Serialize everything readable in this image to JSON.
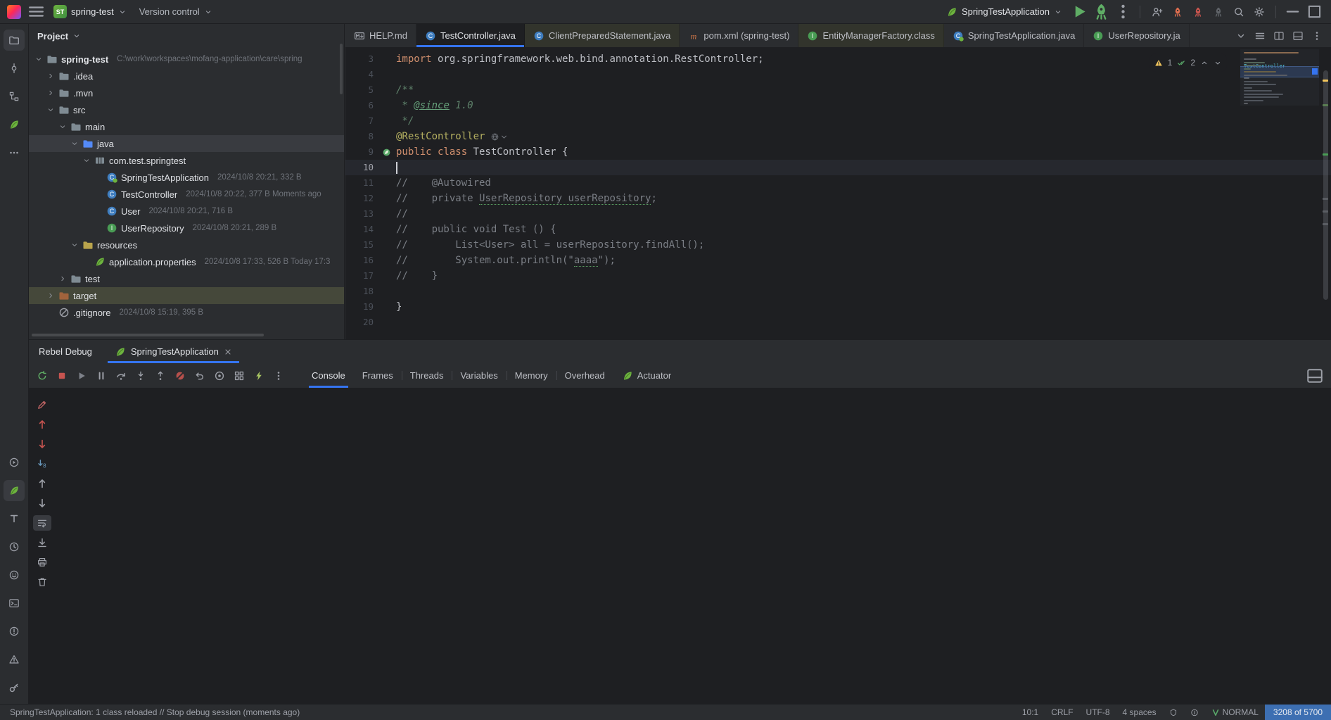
{
  "titlebar": {
    "project_badge": "ST",
    "project_name": "spring-test",
    "version_control": "Version control",
    "run_config": "SpringTestApplication",
    "actions": [
      {
        "name": "collaboration",
        "icon": "user-plus",
        "color": "#9da0a8"
      },
      {
        "name": "jrebel-rocket",
        "icon": "rocket",
        "color": "#DF6E4F"
      },
      {
        "name": "xrebel-rocket",
        "icon": "rocket",
        "color": "#C9554E"
      },
      {
        "name": "rebel-inactive",
        "icon": "rocket",
        "color": "#5f6368"
      },
      {
        "name": "search-everywhere",
        "icon": "search",
        "color": "#9da0a8"
      },
      {
        "name": "settings",
        "icon": "gear",
        "color": "#9da0a8"
      }
    ]
  },
  "left_strip": {
    "top": [
      {
        "name": "project",
        "icon": "folder-tool",
        "active": true
      },
      {
        "name": "commit",
        "icon": "commit"
      },
      {
        "name": "structure",
        "icon": "structure"
      },
      {
        "name": "spring",
        "icon": "leaf"
      },
      {
        "name": "more-tool-windows",
        "icon": "dots-h"
      }
    ],
    "bottom": [
      {
        "name": "services",
        "icon": "services"
      },
      {
        "name": "spring-debug",
        "icon": "leaf",
        "active": true
      },
      {
        "name": "jrebel-tool",
        "icon": "letter-t"
      },
      {
        "name": "profiler",
        "icon": "clock"
      },
      {
        "name": "assistant",
        "icon": "smile"
      },
      {
        "name": "terminal",
        "icon": "terminal"
      },
      {
        "name": "problems",
        "icon": "error-circle"
      },
      {
        "name": "notifications",
        "icon": "warning-outline"
      },
      {
        "name": "endpoints",
        "icon": "key"
      }
    ]
  },
  "project_panel": {
    "title": "Project",
    "tree": [
      {
        "name": "spring-test",
        "meta": "C:\\work\\workspaces\\mofang-application\\care\\spring",
        "level": 0,
        "chevron": "down",
        "icon": "folder",
        "nameClass": "root"
      },
      {
        "name": ".idea",
        "level": 1,
        "chevron": "right",
        "icon": "folder"
      },
      {
        "name": ".mvn",
        "level": 1,
        "chevron": "right",
        "icon": "folder"
      },
      {
        "name": "src",
        "level": 1,
        "chevron": "down",
        "icon": "folder"
      },
      {
        "name": "main",
        "level": 2,
        "chevron": "down",
        "icon": "folder"
      },
      {
        "name": "java",
        "level": 3,
        "chevron": "down",
        "icon": "folder-source",
        "selected": true
      },
      {
        "name": "com.test.springtest",
        "level": 4,
        "chevron": "down",
        "icon": "package"
      },
      {
        "name": "SpringTestApplication",
        "meta": "2024/10/8 20:21, 332 B",
        "level": 5,
        "icon": "class-spring"
      },
      {
        "name": "TestController",
        "meta": "2024/10/8 20:22, 377 B Moments ago",
        "level": 5,
        "icon": "class"
      },
      {
        "name": "User",
        "meta": "2024/10/8 20:21, 716 B",
        "level": 5,
        "icon": "class"
      },
      {
        "name": "UserRepository",
        "meta": "2024/10/8 20:21, 289 B",
        "level": 5,
        "icon": "interface"
      },
      {
        "name": "resources",
        "level": 3,
        "chevron": "down",
        "icon": "folder-resources"
      },
      {
        "name": "application.properties",
        "meta": "2024/10/8 17:33, 526 B Today 17:3",
        "level": 4,
        "icon": "leaf"
      },
      {
        "name": "test",
        "level": 2,
        "chevron": "right",
        "icon": "folder"
      },
      {
        "name": "target",
        "level": 1,
        "chevron": "right",
        "icon": "folder-excluded",
        "rowClass": "excluded"
      },
      {
        "name": ".gitignore",
        "meta": "2024/10/8 15:19, 395 B",
        "level": 1,
        "icon": "ignored"
      }
    ]
  },
  "editor": {
    "tabs": [
      {
        "label": "HELP.md",
        "icon": "markdown"
      },
      {
        "label": "TestController.java",
        "icon": "class",
        "active": true
      },
      {
        "label": "ClientPreparedStatement.java",
        "icon": "class",
        "tint": true
      },
      {
        "label": "pom.xml (spring-test)",
        "icon": "maven"
      },
      {
        "label": "EntityManagerFactory.class",
        "icon": "interface",
        "tint": true
      },
      {
        "label": "SpringTestApplication.java",
        "icon": "class-spring"
      },
      {
        "label": "UserRepository.ja",
        "icon": "interface"
      }
    ],
    "tab_actions": [
      {
        "name": "hidden-tabs",
        "icon": "chevron-down"
      },
      {
        "name": "recent-files-list",
        "icon": "hamburger"
      },
      {
        "name": "split-editor",
        "icon": "split"
      },
      {
        "name": "editor-layout",
        "icon": "layout-bottom"
      },
      {
        "name": "editor-options",
        "icon": "dots-v"
      }
    ],
    "inspections": {
      "warnings": "1",
      "ok": "2"
    },
    "minimap_label": "TestController",
    "code": [
      {
        "n": 3,
        "t": [
          {
            "s": "import",
            "c": "kw"
          },
          {
            "s": " org.springframework.web.bind.annotation.RestController;",
            "c": "pl"
          }
        ]
      },
      {
        "n": 4,
        "t": []
      },
      {
        "n": 5,
        "t": [
          {
            "s": "/**",
            "c": "doc"
          }
        ]
      },
      {
        "n": 6,
        "t": [
          {
            "s": " * ",
            "c": "doc"
          },
          {
            "s": "@since",
            "c": "doctag"
          },
          {
            "s": " 1.0",
            "c": "doc"
          }
        ]
      },
      {
        "n": 7,
        "t": [
          {
            "s": " */",
            "c": "doc"
          }
        ]
      },
      {
        "n": 8,
        "t": [
          {
            "s": "@RestController",
            "c": "ann"
          }
        ],
        "after": "mapping"
      },
      {
        "n": 9,
        "t": [
          {
            "s": "public class ",
            "c": "kw"
          },
          {
            "s": "TestController {",
            "c": "pl"
          }
        ],
        "gutter": "bean"
      },
      {
        "n": 10,
        "t": [],
        "caret": true
      },
      {
        "n": 11,
        "t": [
          {
            "s": "//    @Autowired",
            "c": "cmt"
          }
        ]
      },
      {
        "n": 12,
        "t": [
          {
            "s": "//    private ",
            "c": "cmt"
          },
          {
            "s": "UserRepository userRepository",
            "c": "cmt wavy"
          },
          {
            "s": ";",
            "c": "cmt"
          }
        ]
      },
      {
        "n": 13,
        "t": [
          {
            "s": "//",
            "c": "cmt"
          }
        ]
      },
      {
        "n": 14,
        "t": [
          {
            "s": "//    public void Test () {",
            "c": "cmt"
          }
        ]
      },
      {
        "n": 15,
        "t": [
          {
            "s": "//        List<User> all = userRepository.findAll();",
            "c": "cmt"
          }
        ]
      },
      {
        "n": 16,
        "t": [
          {
            "s": "//        System.out.println(\"",
            "c": "cmt"
          },
          {
            "s": "aaaa",
            "c": "cmt wavy"
          },
          {
            "s": "\");",
            "c": "cmt"
          }
        ]
      },
      {
        "n": 17,
        "t": [
          {
            "s": "//    }",
            "c": "cmt"
          }
        ]
      },
      {
        "n": 18,
        "t": []
      },
      {
        "n": 19,
        "t": [
          {
            "s": "}",
            "c": "pl"
          }
        ]
      },
      {
        "n": 20,
        "t": []
      }
    ]
  },
  "debug": {
    "title": "Rebel Debug",
    "session_tab": "SpringTestApplication",
    "toolbar": [
      {
        "name": "rerun",
        "icon": "rerun",
        "color": "#5FAD65"
      },
      {
        "name": "stop",
        "icon": "stop"
      },
      {
        "name": "resume",
        "icon": "resume"
      },
      {
        "name": "pause",
        "icon": "pause"
      },
      {
        "name": "step-over",
        "icon": "step-over"
      },
      {
        "name": "step-into",
        "icon": "step-into"
      },
      {
        "name": "step-out",
        "icon": "step-out"
      },
      {
        "name": "mute-breakpoints",
        "icon": "mute-bp"
      },
      {
        "name": "rollback",
        "icon": "undo"
      },
      {
        "name": "view-breakpoints",
        "icon": "circle-dot"
      },
      {
        "name": "dump-threads",
        "icon": "grid"
      },
      {
        "name": "hotswap",
        "icon": "bolt"
      },
      {
        "name": "debug-more",
        "icon": "dots-v"
      }
    ],
    "view_tabs": [
      {
        "label": "Console",
        "active": true
      },
      {
        "label": "Frames"
      },
      {
        "label": "Threads",
        "divider": true
      },
      {
        "label": "Variables",
        "divider": true
      },
      {
        "label": "Memory",
        "divider": true
      },
      {
        "label": "Overhead",
        "divider": true
      },
      {
        "label": "Actuator",
        "icon": "leaf"
      }
    ],
    "side_toolbar": [
      {
        "name": "edit-session",
        "icon": "pencil",
        "color": "#CE6A6A"
      },
      {
        "name": "prev-change",
        "icon": "arrow-up",
        "color": "#C75450"
      },
      {
        "name": "next-change",
        "icon": "arrow-down",
        "color": "#C75450"
      },
      {
        "name": "jump-bottom",
        "icon": "arrow-down-8",
        "color": "#6897BB"
      },
      {
        "name": "up-stack",
        "icon": "arrow-up"
      },
      {
        "name": "down-stack",
        "icon": "arrow-down"
      },
      {
        "name": "soft-wrap",
        "icon": "softwrap",
        "active": true
      },
      {
        "name": "scroll-to-end",
        "icon": "scroll-end"
      },
      {
        "name": "print",
        "icon": "printer"
      },
      {
        "name": "clear-console",
        "icon": "trash"
      }
    ]
  },
  "statusbar": {
    "message": "SpringTestApplication: 1 class reloaded // Stop debug session (moments ago)",
    "cursor": "10:1",
    "line_sep": "CRLF",
    "encoding": "UTF-8",
    "indent": "4 spaces",
    "vim_mode": "NORMAL",
    "memory": "3208 of 5700"
  }
}
